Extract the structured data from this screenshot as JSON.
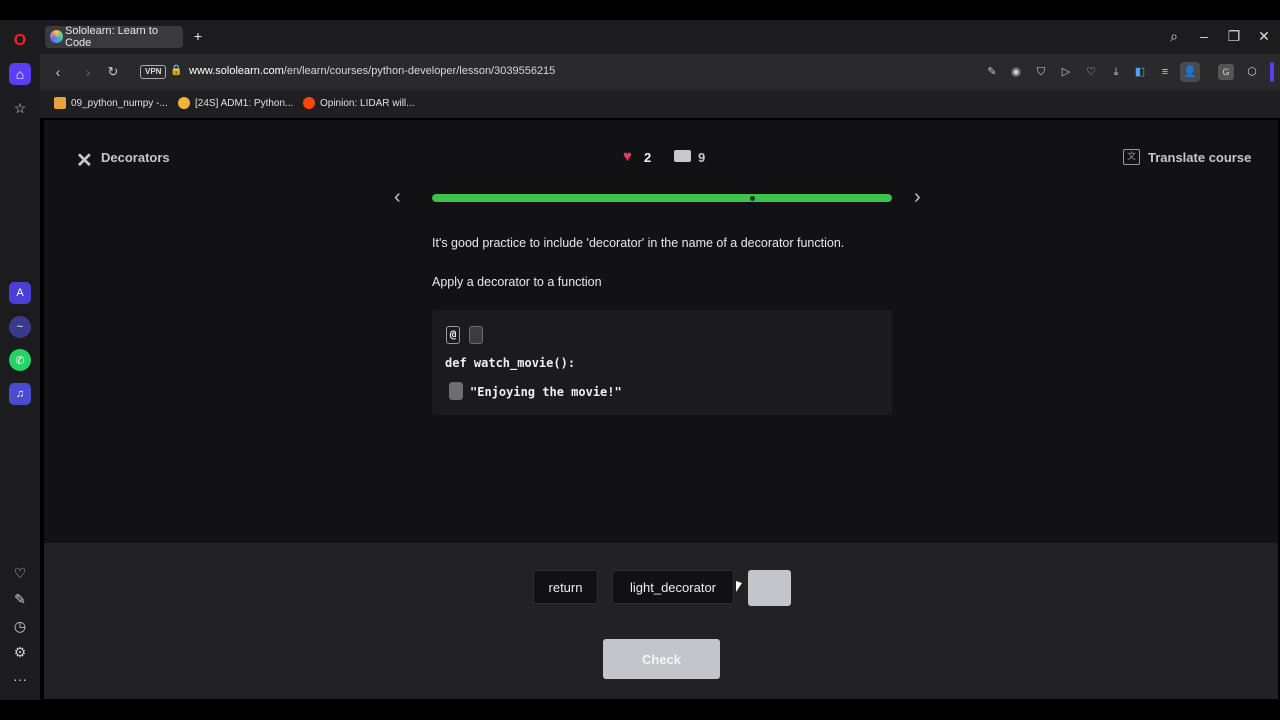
{
  "browser": {
    "tab_title": "Sololearn: Learn to Code",
    "new_tab_glyph": "+",
    "url_host": "www.sololearn.com",
    "url_path": "/en/learn/courses/python-developer/lesson/3039556215",
    "vpn_label": "VPN",
    "bookmarks": [
      {
        "label": "09_python_numpy -...",
        "color": "#e8a33d"
      },
      {
        "label": "[24S] ADM1: Python...",
        "color": "#f2b531"
      },
      {
        "label": "Opinion: LIDAR will...",
        "color": "#ff4500"
      }
    ]
  },
  "lesson": {
    "title": "Decorators",
    "hearts": "2",
    "comments": "9",
    "translate_label": "Translate course",
    "progress_fraction": 1.0,
    "paragraph1": "It's good practice to include 'decorator' in the name of a decorator function.",
    "paragraph2": "Apply a decorator to a function",
    "code": {
      "at_symbol": "@",
      "line2": "def watch_movie():",
      "line3": "\"Enjoying the movie!\""
    }
  },
  "answers": {
    "options": [
      "return",
      "light_decorator"
    ],
    "check_label": "Check"
  },
  "colors": {
    "accent_green": "#3fc14f",
    "heart": "#e33a63",
    "disabled": "#c2c6cb"
  }
}
